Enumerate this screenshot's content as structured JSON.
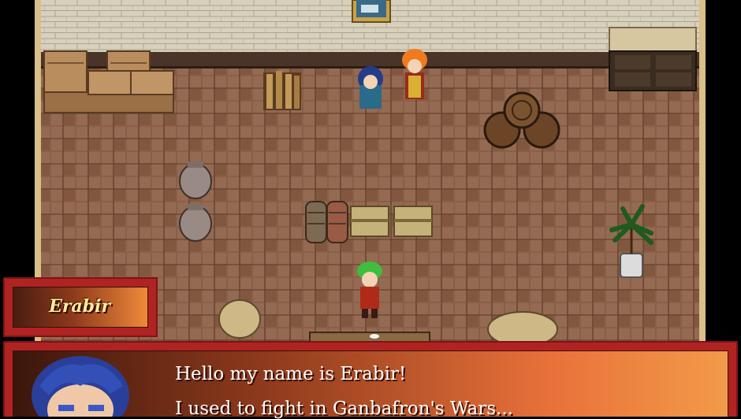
{
  "dialogue": {
    "speaker": "Erabir",
    "lines": [
      "Hello my name is Erabir!",
      "I used to fight in Ganbafron's Wars..."
    ]
  },
  "colors": {
    "dialog_frame": "#b02323",
    "name_text": "#ffef9a",
    "message_text": "#ffffff",
    "floor": "#8a5f47",
    "wall": "#d7d0bc"
  },
  "scene": {
    "location": "storage room",
    "characters": [
      "blue-haired girl",
      "orange-haired man",
      "green-haired player"
    ],
    "objects": [
      "crates",
      "firewood",
      "barrels",
      "pots",
      "rolled mats",
      "chests",
      "potted palm",
      "sacks",
      "painting",
      "cabinet"
    ]
  }
}
